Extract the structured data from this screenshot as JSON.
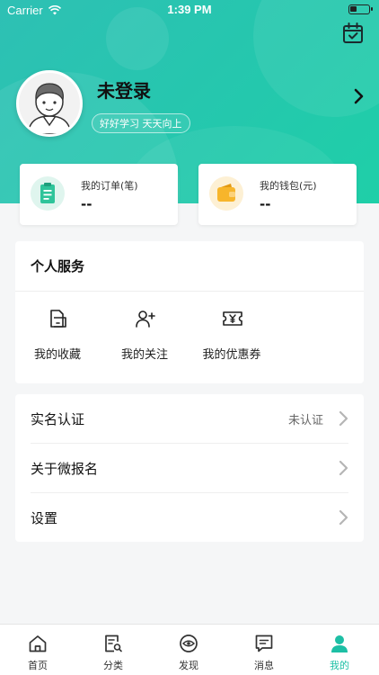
{
  "status_bar": {
    "carrier": "Carrier",
    "time": "1:39 PM",
    "battery_level": 0.35
  },
  "profile": {
    "name": "未登录",
    "motto": "好好学习 天天向上"
  },
  "stats": [
    {
      "label": "我的订单(笔)",
      "value": "--",
      "icon": "order-clipboard-icon",
      "color": "#2ec49a"
    },
    {
      "label": "我的钱包(元)",
      "value": "--",
      "icon": "wallet-icon",
      "color": "#f7b52b"
    }
  ],
  "services": {
    "title": "个人服务",
    "items": [
      {
        "label": "我的收藏",
        "icon": "folder-icon"
      },
      {
        "label": "我的关注",
        "icon": "add-user-icon"
      },
      {
        "label": "我的优惠券",
        "icon": "coupon-icon"
      }
    ]
  },
  "settings": [
    {
      "label": "实名认证",
      "status": "未认证"
    },
    {
      "label": "关于微报名",
      "status": ""
    },
    {
      "label": "设置",
      "status": ""
    }
  ],
  "tabbar": {
    "active_color": "#1dbfa5",
    "items": [
      {
        "label": "首页",
        "icon": "home-icon",
        "active": false
      },
      {
        "label": "分类",
        "icon": "category-search-icon",
        "active": false
      },
      {
        "label": "发现",
        "icon": "eye-icon",
        "active": false
      },
      {
        "label": "消息",
        "icon": "message-icon",
        "active": false
      },
      {
        "label": "我的",
        "icon": "person-icon",
        "active": true
      }
    ]
  }
}
